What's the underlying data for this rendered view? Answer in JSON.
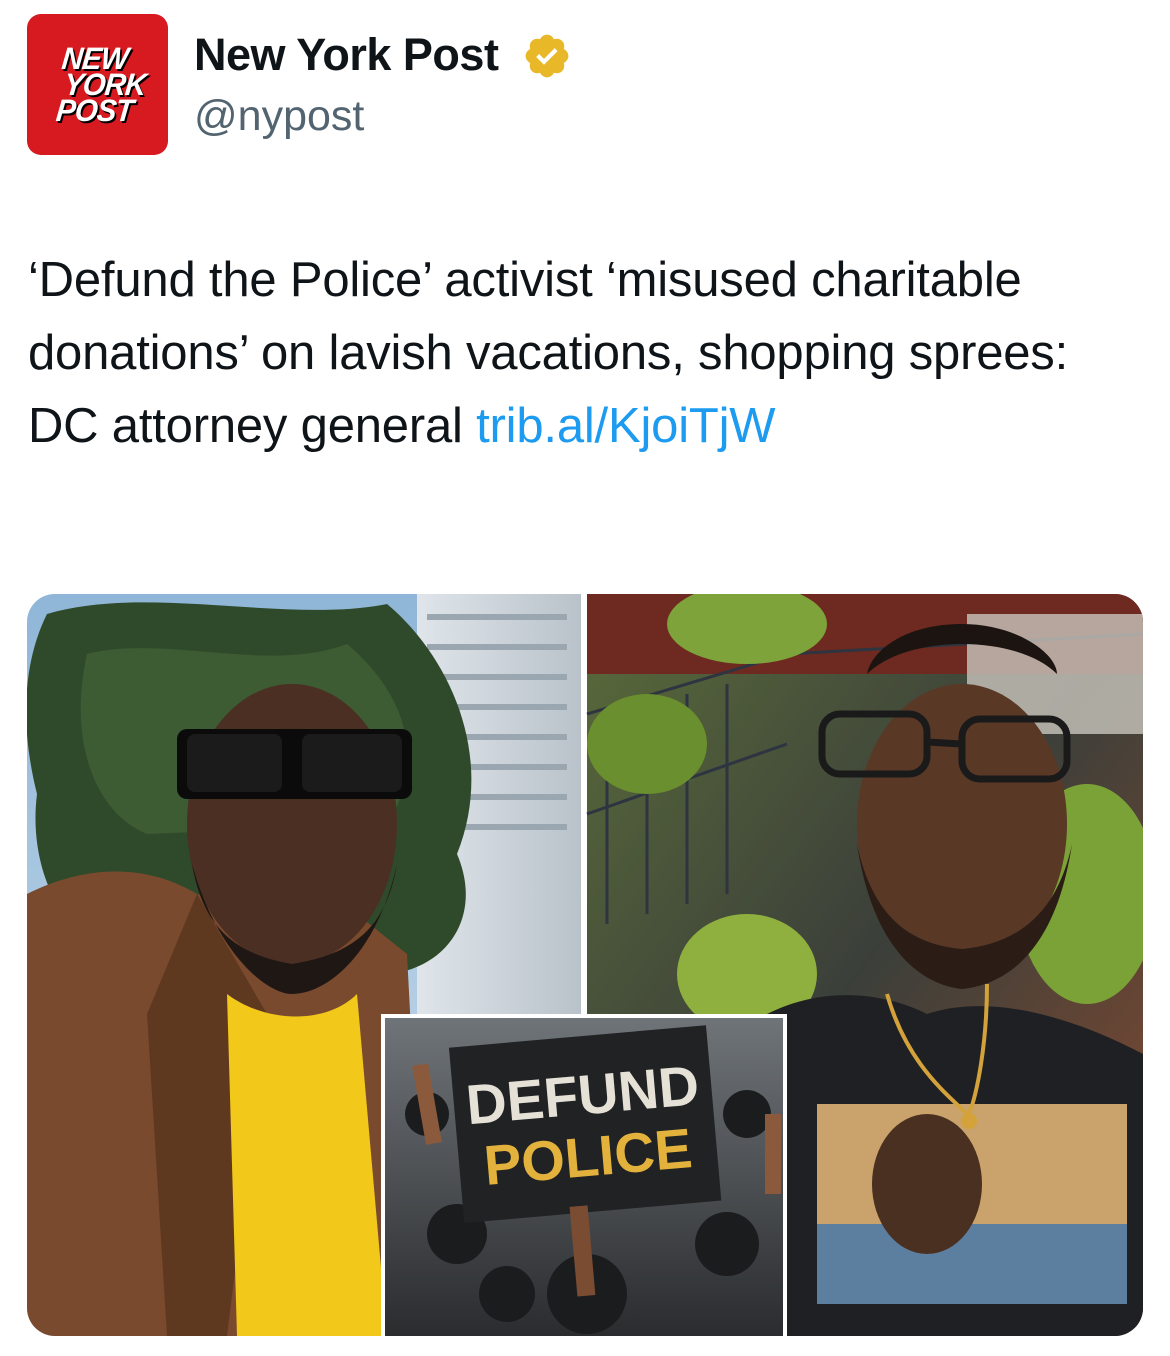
{
  "author": {
    "display_name": "New York Post",
    "handle": "@nypost",
    "avatar_text": [
      "NEW",
      "YORK",
      "POST"
    ],
    "verified_icon": "verified-badge-gold"
  },
  "tweet": {
    "text": "‘Defund the Police’ activist ‘misused charitable donations’ on lavish vacations, shopping sprees: DC attorney general ",
    "link_text": "trib.al/KjoiTjW"
  },
  "media": {
    "sign_text_line1": "DEFUND",
    "sign_text_line2": "POLICE"
  },
  "colors": {
    "brand_red": "#d71920",
    "link_blue": "#1d9bf0",
    "verified_gold": "#e8b829",
    "handle_gray": "#536471"
  }
}
